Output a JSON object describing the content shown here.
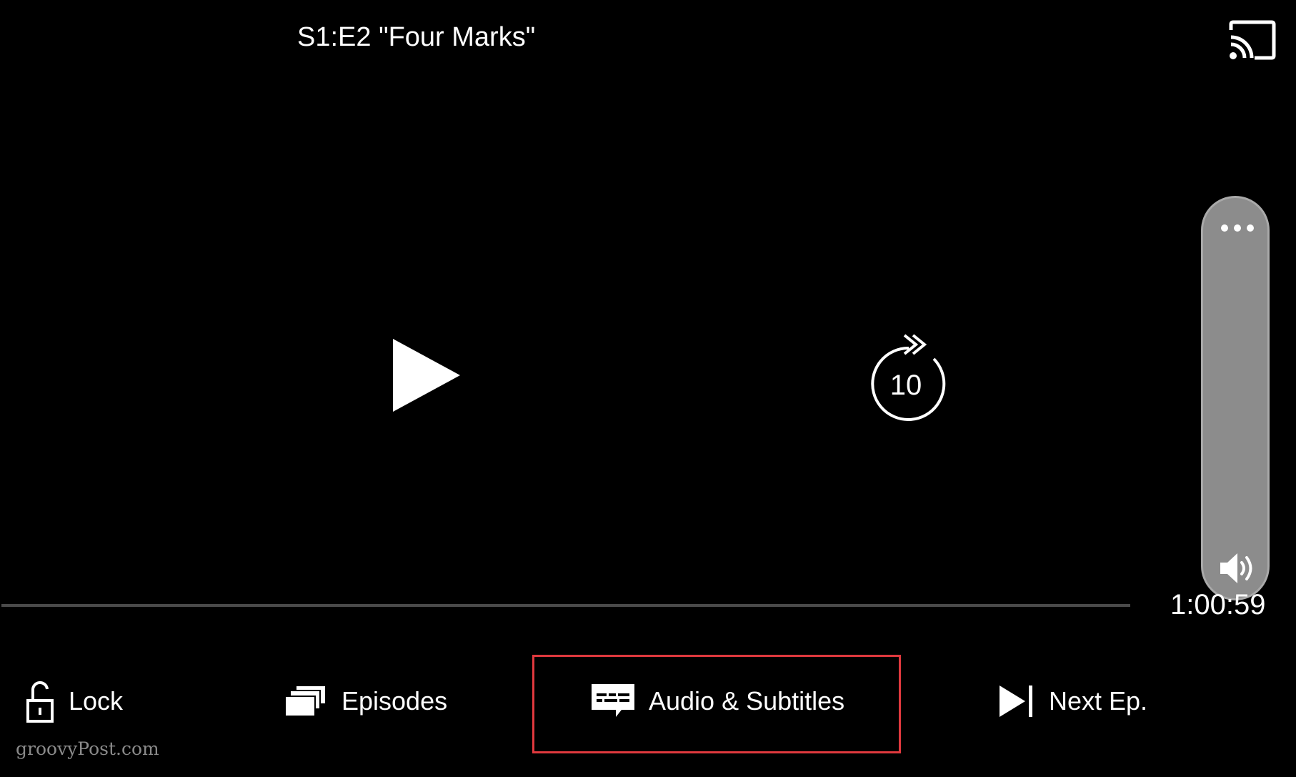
{
  "header": {
    "episode_title": "S1:E2 \"Four Marks\"",
    "cast_icon": "cast-icon"
  },
  "center_controls": {
    "play_icon": "play-icon",
    "skip_forward_seconds": "10"
  },
  "volume": {
    "more_icon": "more-icon",
    "volume_icon": "volume-icon"
  },
  "progress": {
    "played_fraction": 0,
    "time_remaining": "1:00:59"
  },
  "toolbar": {
    "lock_label": "Lock",
    "episodes_label": "Episodes",
    "audio_subtitles_label": "Audio & Subtitles",
    "next_episode_label": "Next Ep."
  },
  "colors": {
    "background": "#000000",
    "highlight": "#e0393e",
    "slider": "#8c8c8c"
  },
  "watermark": "groovyPost.com"
}
